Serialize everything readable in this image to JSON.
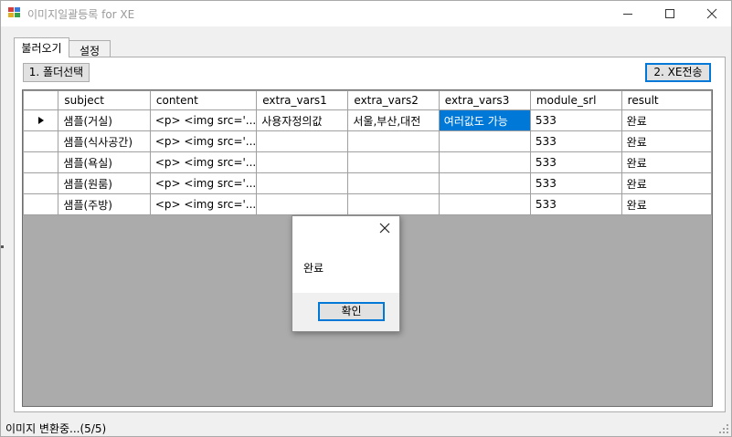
{
  "window": {
    "title": "이미지일괄등록 for XE",
    "icon": "app-window-icon",
    "controls": [
      "minimize-icon",
      "maximize-icon",
      "close-icon"
    ]
  },
  "tabs": [
    {
      "label": "불러오기",
      "active": true
    },
    {
      "label": "설정",
      "active": false
    }
  ],
  "toolbar": {
    "select_folder_label": "1. 폴더선택",
    "send_label": "2. XE전송"
  },
  "grid": {
    "columns": [
      "subject",
      "content",
      "extra_vars1",
      "extra_vars2",
      "extra_vars3",
      "module_srl",
      "result"
    ],
    "rows": [
      {
        "current": true,
        "cells": [
          "샘플(거실)",
          "<p> <img src='...",
          "사용자정의값",
          "서울,부산,대전",
          "여러값도 가능",
          "533",
          "완료"
        ]
      },
      {
        "current": false,
        "cells": [
          "샘플(식사공간)",
          "<p> <img src='...",
          "",
          "",
          "",
          "533",
          "완료"
        ]
      },
      {
        "current": false,
        "cells": [
          "샘플(욕실)",
          "<p> <img src='...",
          "",
          "",
          "",
          "533",
          "완료"
        ]
      },
      {
        "current": false,
        "cells": [
          "샘플(원룸)",
          "<p> <img src='...",
          "",
          "",
          "",
          "533",
          "완료"
        ]
      },
      {
        "current": false,
        "cells": [
          "샘플(주방)",
          "<p> <img src='...",
          "",
          "",
          "",
          "533",
          "완료"
        ]
      }
    ],
    "selected_cell": {
      "row": 0,
      "col": 4
    }
  },
  "dialog": {
    "message": "완료",
    "ok_label": "확인"
  },
  "status": {
    "text": "이미지 변환중...(5/5)"
  },
  "colors": {
    "selection": "#0078d7",
    "grid_background": "#ababab",
    "focus_border": "#0078d7",
    "title_text": "#9a9a9a"
  }
}
